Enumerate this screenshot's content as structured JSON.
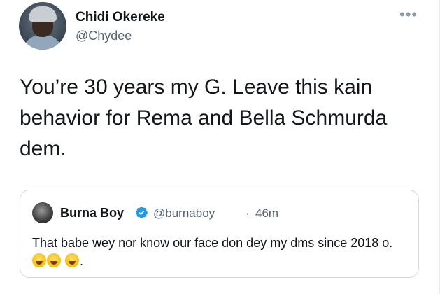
{
  "tweet": {
    "author_name": "Chidi Okereke",
    "author_handle": "@Chydee",
    "more_icon": "•••",
    "text": "You’re 30 years my G. Leave this kain behavior for Rema and Bella Schmurda dem."
  },
  "quoted_tweet": {
    "author_name": "Burna Boy",
    "author_handle": "@burnaboy",
    "separator": "·",
    "time": "46m",
    "text_start": "That babe wey nor know our face don dey my dms since 2018 o. ",
    "text_end": "."
  },
  "colors": {
    "verified": "#1d9bf0",
    "secondary_text": "#536471",
    "border": "#cfd9de"
  }
}
